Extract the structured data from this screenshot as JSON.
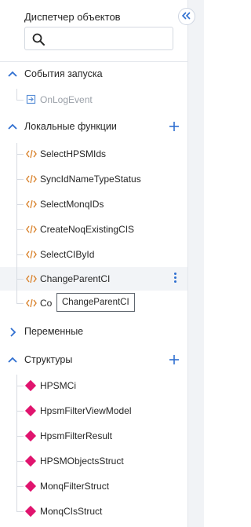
{
  "header": {
    "title": "Диспетчер объектов"
  },
  "search": {
    "placeholder": "",
    "value": ""
  },
  "sections": [
    {
      "label": "События запуска",
      "expanded": true,
      "items": [
        {
          "label": "OnLogEvent",
          "disabled": true
        }
      ]
    },
    {
      "label": "Локальные функции",
      "expanded": true,
      "items": [
        {
          "label": "SelectHPSMIds"
        },
        {
          "label": "SyncIdNameTypeStatus"
        },
        {
          "label": "SelectMonqIDs"
        },
        {
          "label": "CreateNoqExistingCIS"
        },
        {
          "label": "SelectCIById"
        },
        {
          "label": "ChangeParentCI",
          "hovered": true
        },
        {
          "label": "Co"
        }
      ]
    },
    {
      "label": "Переменные",
      "expanded": false,
      "items": []
    },
    {
      "label": "Структуры",
      "expanded": true,
      "items": [
        {
          "label": "HPSMCi"
        },
        {
          "label": "HpsmFilterViewModel"
        },
        {
          "label": "HpsmFilterResult"
        },
        {
          "label": "HPSMObjectsStruct"
        },
        {
          "label": "MonqFilterStruct"
        },
        {
          "label": "MonqCIsStruct"
        }
      ]
    }
  ],
  "tooltip": {
    "text": "ChangeParentCI"
  },
  "colors": {
    "accent": "#2f6fd0",
    "function_icon": "#d9822b",
    "struct_icon": "#e0146e",
    "event_icon": "#5b8fd6",
    "hover_bg": "#f2f4f7"
  }
}
